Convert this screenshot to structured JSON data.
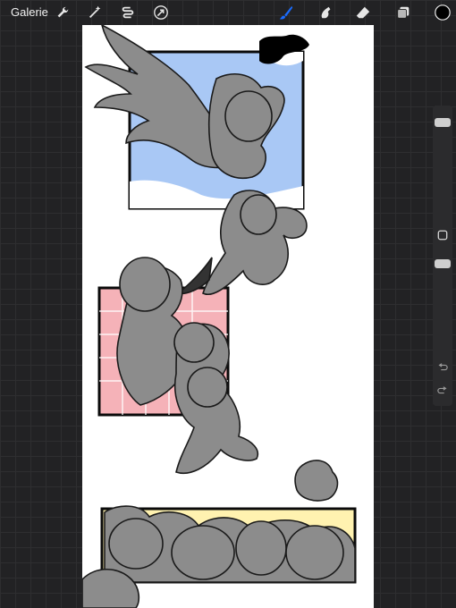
{
  "toolbar": {
    "gallery_label": "Galerie",
    "left_tools": [
      {
        "icon": "wrench-icon"
      },
      {
        "icon": "magic-wand-icon"
      },
      {
        "icon": "selection-icon"
      },
      {
        "icon": "transform-arrow-icon"
      }
    ],
    "right_tools": [
      {
        "icon": "brush-icon",
        "active": true
      },
      {
        "icon": "smudge-icon"
      },
      {
        "icon": "eraser-icon"
      },
      {
        "icon": "layers-icon"
      },
      {
        "icon": "color-swatch-icon"
      }
    ],
    "active_color": "#1a6cff",
    "swatch_color": "#000000"
  },
  "canvas": {
    "background": "#ffffff",
    "panels": [
      {
        "name": "sky-panel",
        "fill": "#a9c8f5"
      },
      {
        "name": "pink-grid-panel",
        "fill": "#f5b2b8"
      },
      {
        "name": "yellow-strip-panel",
        "fill": "#fff2b0"
      }
    ],
    "figure_fill": "#8c8c8c"
  },
  "sidebar": {
    "brush_size_level": 0.05,
    "opacity_level": 0.8
  }
}
